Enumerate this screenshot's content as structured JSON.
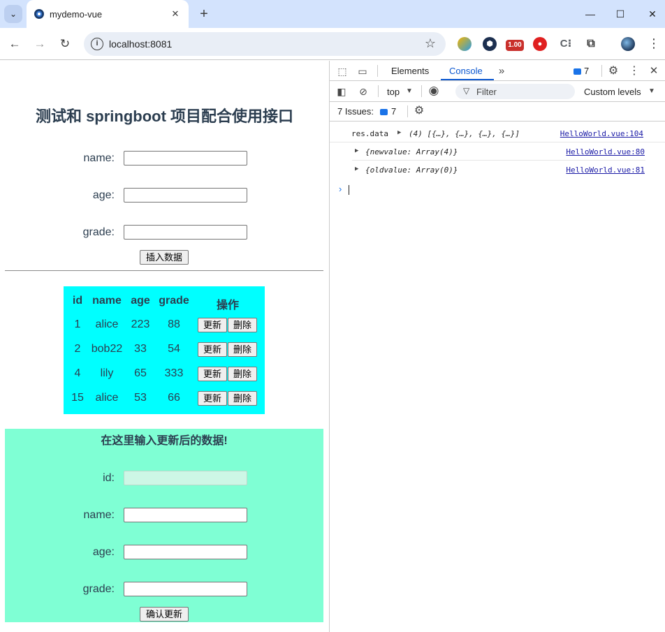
{
  "browser": {
    "tab_title": "mydemo-vue",
    "url": "localhost:8081",
    "ext_badge": "1.00"
  },
  "page": {
    "title": "测试和 springboot 项目配合使用接口",
    "insert_form": {
      "name_label": "name:",
      "age_label": "age:",
      "grade_label": "grade:",
      "submit_label": "插入数据"
    },
    "table": {
      "headers": [
        "id",
        "name",
        "age",
        "grade",
        "操作"
      ],
      "rows": [
        {
          "id": "1",
          "name": "alice",
          "age": "223",
          "grade": "88"
        },
        {
          "id": "2",
          "name": "bob22",
          "age": "33",
          "grade": "54"
        },
        {
          "id": "4",
          "name": "lily",
          "age": "65",
          "grade": "333"
        },
        {
          "id": "15",
          "name": "alice",
          "age": "53",
          "grade": "66"
        }
      ],
      "update_label": "更新",
      "delete_label": "删除",
      "bg_color": "#00ffff"
    },
    "update_form": {
      "title": "在这里输入更新后的数据!",
      "id_label": "id:",
      "name_label": "name:",
      "age_label": "age:",
      "grade_label": "grade:",
      "confirm_label": "确认更新",
      "bg_color": "#7fffd4"
    }
  },
  "devtools": {
    "tabs": [
      "Elements",
      "Console"
    ],
    "active_tab": "Console",
    "message_count": "7",
    "context": "top",
    "filter_placeholder": "Filter",
    "levels": "Custom levels",
    "issues_label": "7 Issues:",
    "issues_count": "7",
    "logs": [
      {
        "label": "res.data",
        "value": "(4) [{…}, {…}, {…}, {…}]",
        "source": "HelloWorld.vue:104"
      },
      {
        "label": "",
        "value": "{newvalue: Array(4)}",
        "source": "HelloWorld.vue:80"
      },
      {
        "label": "",
        "value": "{oldvalue: Array(0)}",
        "source": "HelloWorld.vue:81"
      }
    ]
  }
}
